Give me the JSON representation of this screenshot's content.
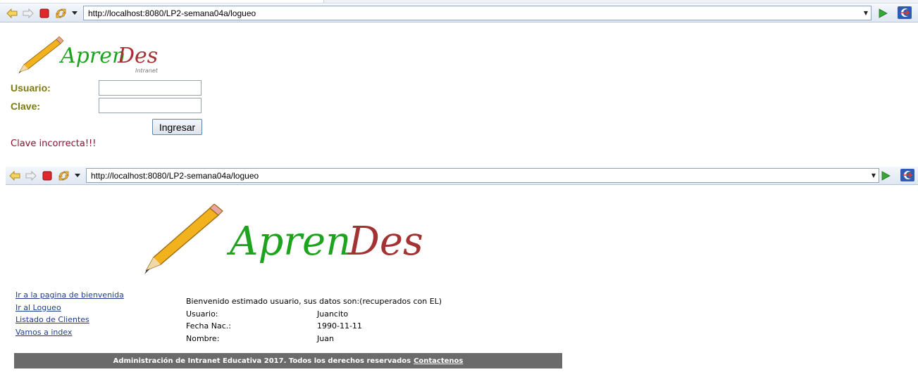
{
  "browser_top": {
    "url": "http://localhost:8080/LP2-semana04a/logueo",
    "icons": [
      "back-arrow-icon",
      "forward-arrow-icon",
      "stop-icon",
      "refresh-icon",
      "dropdown-arrow-icon",
      "go-icon",
      "eclipse-icon"
    ]
  },
  "browser_bottom": {
    "url": "http://localhost:8080/LP2-semana04a/logueo"
  },
  "logo": {
    "apren": "Apren",
    "des": "Des",
    "intranet": "Intranet",
    "icon": "pencil-icon"
  },
  "login": {
    "usuario_label": "Usuario:",
    "clave_label": "Clave:",
    "usuario_value": "",
    "clave_value": "",
    "submit_label": "Ingresar",
    "error": "Clave incorrecta!!!"
  },
  "welcome": {
    "links": [
      "Ir a la pagina de bienvenida",
      "Ir al Logueo",
      "Listado de Clientes",
      "Vamos a index"
    ],
    "intro": "Bienvenido estimado usuario, sus datos son:(recuperados con EL)",
    "fields": [
      {
        "label": "Usuario:",
        "value": "Juancito"
      },
      {
        "label": "Fecha Nac.:",
        "value": "1990-11-11"
      },
      {
        "label": "Nombre:",
        "value": "Juan"
      }
    ],
    "footer_text": "Administración de Intranet Educativa 2017. Todos los derechos reservados",
    "footer_link": "Contactenos"
  },
  "colors": {
    "label_olive": "#7d7a14",
    "error_red": "#8a1030",
    "link_blue": "#1e3d8f",
    "footer_gray": "#6b6b6b",
    "logo_green": "#1ea31e",
    "logo_red": "#a33232"
  }
}
